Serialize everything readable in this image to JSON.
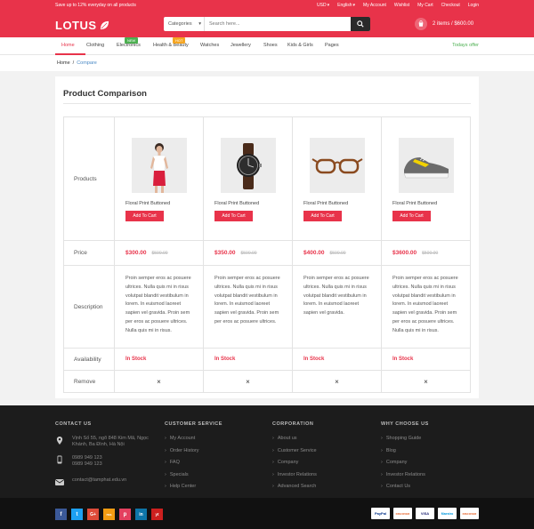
{
  "topbar": {
    "promo": "Save up to 12% everyday on all products",
    "links": [
      "USD",
      "English",
      "My Account",
      "Wishlist",
      "My Cart",
      "Checkout",
      "Login"
    ]
  },
  "header": {
    "logo": "LOTUS",
    "search_category": "Categories",
    "search_placeholder": "Search here...",
    "cart_text": "2 items / $600.00"
  },
  "nav": {
    "items": [
      "Home",
      "Clothing",
      "Electronics",
      "Health & Beauty",
      "Watches",
      "Jewellery",
      "Shoes",
      "Kids & Girls",
      "Pages"
    ],
    "badges": {
      "electronics": "NEW",
      "health": "HOT"
    },
    "today": "Todays offer"
  },
  "breadcrumb": {
    "home": "Home",
    "separator": "/",
    "current": "Compare"
  },
  "page_title": "Product Comparison",
  "row_labels": {
    "products": "Products",
    "price": "Price",
    "description": "Description",
    "availability": "Availability",
    "remove": "Remove"
  },
  "products": [
    {
      "name": "Floral Print Buttoned",
      "button": "Add To Cart",
      "price": "$300.00",
      "old_price": "$500.00",
      "availability": "In Stock",
      "remove": "×",
      "image": "woman-model",
      "description": "Proin semper eros ac posuere ultrices. Nulla quis mi in risus volutpat blandit vestibulum in lorem. In euismod laoreet sapien vel gravida. Proin sem per eros ac posuere ultrices. Nulla quis mi in risus."
    },
    {
      "name": "Floral Print Buttoned",
      "button": "Add To Cart",
      "price": "$350.00",
      "old_price": "$500.00",
      "availability": "In Stock",
      "remove": "×",
      "image": "wristwatch",
      "description": "Proin semper eros ac posuere ultrices. Nulla quis mi in risus volutpat blandit vestibulum in lorem. In euismod laoreet sapien vel gravida. Proin sem per eros ac posuere ultrices."
    },
    {
      "name": "Floral Print Buttoned",
      "button": "Add To Cart",
      "price": "$400.00",
      "old_price": "$500.00",
      "availability": "In Stock",
      "remove": "×",
      "image": "eyeglasses",
      "description": "Proin semper eros ac posuere ultrices. Nulla quis mi in risus volutpat blandit vestibulum in lorem. In euismod laoreet sapien vel gravida."
    },
    {
      "name": "Floral Print Buttoned",
      "button": "Add To Cart",
      "price": "$3600.00",
      "old_price": "$500.00",
      "availability": "In Stock",
      "remove": "×",
      "image": "sneaker",
      "description": "Proin semper eros ac posuere ultrices. Nulla quis mi in risus volutpat blandit vestibulum in lorem. In euismod laoreet sapien vel gravida. Proin sem per eros ac posuere ultrices. Nulla quis mi in risus."
    }
  ],
  "footer": {
    "contact": {
      "head": "CONTACT US",
      "address": "Vịnh Số 55, ngõ 848 Kim Mã, Ngọc Khánh, Ba Đình, Hà Nội",
      "phone1": "0989 949 123",
      "phone2": "0989 949 123",
      "email": "contact@tamphat.edu.vn"
    },
    "service": {
      "head": "CUSTOMER SERVICE",
      "items": [
        "My Account",
        "Order History",
        "FAQ",
        "Specials",
        "Help Center"
      ]
    },
    "corporation": {
      "head": "CORPORATION",
      "items": [
        "About us",
        "Customer Service",
        "Company",
        "Investor Relations",
        "Advanced Search"
      ]
    },
    "why": {
      "head": "WHY CHOOSE US",
      "items": [
        "Shopping Guide",
        "Blog",
        "Company",
        "Investor Relations",
        "Contact Us"
      ]
    }
  },
  "social": [
    "f",
    "t",
    "G+",
    "rss",
    "p",
    "in",
    "yt"
  ],
  "payments": [
    "PayPal",
    "DISCOVER",
    "VISA",
    "Maestro",
    "DISCOVER"
  ],
  "colors": {
    "accent": "#e8334a",
    "footer": "#1c1c1c",
    "green": "#4caf50"
  }
}
